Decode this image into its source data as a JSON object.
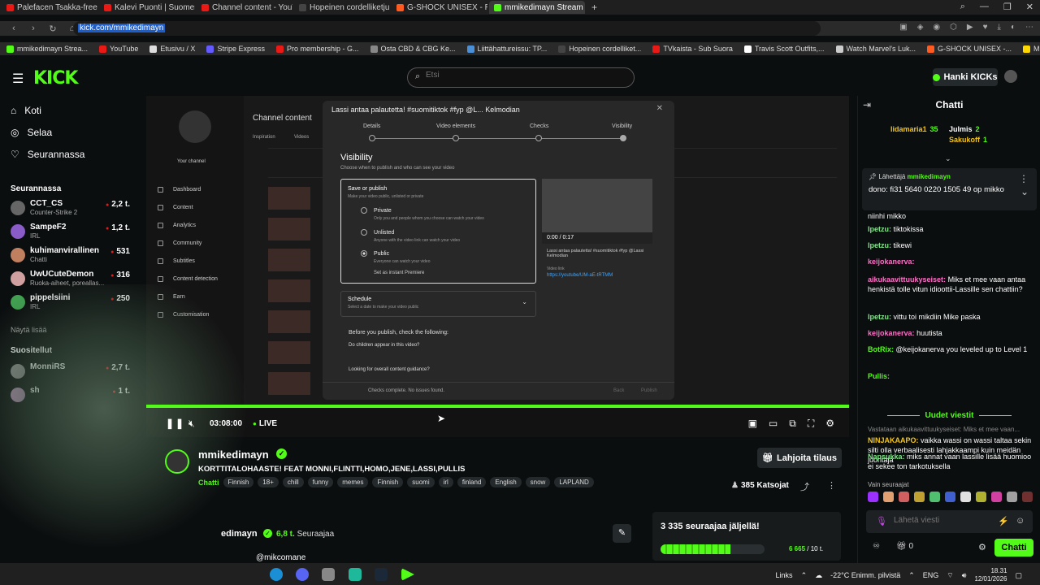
{
  "browser": {
    "tabs": [
      {
        "label": "Palefacen Tsakka-freestyl",
        "color": "#e91916",
        "active": false
      },
      {
        "label": "Kalevi Puonti | Suomen h",
        "color": "#e91916",
        "active": false
      },
      {
        "label": "Channel content - YouTu",
        "color": "#e91916",
        "active": false
      },
      {
        "label": "Hopeinen cordelliketju -",
        "color": "#444444",
        "active": false
      },
      {
        "label": "G-SHOCK UNISEX - Rann",
        "color": "#ff5a1f",
        "active": false
      },
      {
        "label": "mmikedimayn Stream -",
        "color": "#53fc18",
        "active": true
      }
    ],
    "url": "kick.com/mmikedimayn",
    "bookmarks": [
      {
        "label": "mmikedimayn Strea...",
        "color": "#53fc18"
      },
      {
        "label": "YouTube",
        "color": "#e91916"
      },
      {
        "label": "Etusivu / X",
        "color": "#dddddd"
      },
      {
        "label": "Stripe Express",
        "color": "#635bff"
      },
      {
        "label": "Pro membership - G...",
        "color": "#e91916"
      },
      {
        "label": "Osta CBD & CBG Ke...",
        "color": "#888888"
      },
      {
        "label": "Liittähattureissu: TP...",
        "color": "#4a90d9"
      },
      {
        "label": "Hopeinen cordelliket...",
        "color": "#444444"
      },
      {
        "label": "TVkaista - Sub Suora",
        "color": "#e91916"
      },
      {
        "label": "Travis Scott Outfits,...",
        "color": "#ffffff"
      },
      {
        "label": "Watch Marvel's Luk...",
        "color": "#cccccc"
      },
      {
        "label": "G-SHOCK UNISEX -...",
        "color": "#ff5a1f"
      },
      {
        "label": "Mighty Ducks: Bank...",
        "color": "#ffd700"
      }
    ]
  },
  "header": {
    "logo": "KICK",
    "search_placeholder": "Etsi",
    "kicks_label": "Hanki KICKs"
  },
  "sidebar": {
    "nav": [
      {
        "label": "Koti",
        "icon": "home-icon"
      },
      {
        "label": "Selaa",
        "icon": "compass-icon"
      },
      {
        "label": "Seurannassa",
        "icon": "heart-icon"
      }
    ],
    "following_title": "Seurannassa",
    "following": [
      {
        "name": "CCT_CS",
        "category": "Counter-Strike 2",
        "viewers": "2,2 t.",
        "color": "#666666"
      },
      {
        "name": "SampeF2",
        "category": "IRL",
        "viewers": "1,2 t.",
        "color": "#8a5cc8"
      },
      {
        "name": "kuhimanvirallinen",
        "category": "Chatti",
        "viewers": "531",
        "color": "#c08060"
      },
      {
        "name": "UwUCuteDemon",
        "category": "Ruoka-aiheet, poreallas...",
        "viewers": "316",
        "color": "#d0a0a0"
      },
      {
        "name": "pippelsiini",
        "category": "IRL",
        "viewers": "250",
        "color": "#40a050"
      }
    ],
    "show_more": "Näytä lisää",
    "recommended_title": "Suositellut",
    "recommended": [
      {
        "name": "MonniRS",
        "category": "",
        "viewers": "2,7 t.",
        "color": "#888888"
      },
      {
        "name": "sh",
        "category": "",
        "viewers": "1 t.",
        "color": "#aa88aa"
      }
    ]
  },
  "studio": {
    "page_title": "Channel content",
    "your_channel": "Your channel",
    "nav": [
      "Dashboard",
      "Content",
      "Analytics",
      "Community",
      "Subtitles",
      "Content detection",
      "Earn",
      "Customisation"
    ],
    "tabs": [
      "Inspiration",
      "Videos"
    ],
    "dialog": {
      "title": "Lassi antaa palautetta! #suomitiktok #fyp @L... Kelmodian",
      "steps": [
        "Details",
        "Video elements",
        "Checks",
        "Visibility"
      ],
      "visibility_title": "Visibility",
      "visibility_sub": "Choose when to publish and who can see your video",
      "save_title": "Save or publish",
      "save_sub": "Make your video public, unlisted or private",
      "options": [
        {
          "label": "Private",
          "sub": "Only you and people whom you choose can watch your video",
          "on": false
        },
        {
          "label": "Unlisted",
          "sub": "Anyone with the video link can watch your video",
          "on": false
        },
        {
          "label": "Public",
          "sub": "Everyone can watch your video",
          "on": true
        }
      ],
      "premiere": "Set as instant Premiere",
      "preview_time": "0:00 / 0:17",
      "video_title": "Lassi antaa palautetta! #suomitiktok #fyp @Lassi Kelmodian",
      "video_link_label": "Video link",
      "video_link": "https://youtube/UM-aE-tRTMM",
      "schedule": "Schedule",
      "schedule_sub": "Select a date to make your video public",
      "check_title": "Before you publish, check the following:",
      "check_1": "Do children appear in this video?",
      "check_2": "Looking for overall content guidance?",
      "footer_status": "Checks complete. No issues found.",
      "back": "Back",
      "publish": "Publish"
    }
  },
  "player": {
    "time": "03:08:00",
    "live": "LIVE"
  },
  "stream": {
    "name": "mmikedimayn",
    "title": "KORTTITALOHAASTE! FEAT MONNI,FLINTTI,HOMO,JENE,LASSI,PULLIS",
    "category": "Chatti",
    "tags": [
      "Finnish",
      "18+",
      "chill",
      "funny",
      "memes",
      "Finnish",
      "suomi",
      "irl",
      "finland",
      "English",
      "snow",
      "LAPLAND"
    ],
    "subscribe_label": "Lahjoita tilaus",
    "viewers": "385 Katsojat",
    "about_name": "edimayn",
    "followers_count": "6,8 t.",
    "followers_label": "Seuraajaa",
    "social": "@mikcomane",
    "goal_title": "3 335 seuraajaa jäljellä!",
    "goal_current": "6 665",
    "goal_target": "/ 10 t.",
    "goal_progress": 0.67
  },
  "chat": {
    "title": "Chatti",
    "leaders": [
      {
        "name": "lidamaria1",
        "val": "35",
        "color": "#f5c518"
      },
      {
        "name": "Julmis",
        "val": "2",
        "color": "#ffffff"
      },
      {
        "name": "Sakukoff",
        "val": "1",
        "color": "#f5c518"
      }
    ],
    "pinned_by": "Lähettäjä",
    "pinned_user": "mmikedimayn",
    "pinned_text": "dono: fi31 5640 0220 1505 49 op mikko",
    "messages": [
      {
        "user": "",
        "text": "niinhi mikko",
        "color": "#ffffff"
      },
      {
        "user": "Ipetzu:",
        "text": "tiktokissa",
        "color": "#7ee787"
      },
      {
        "user": "Ipetzu:",
        "text": "tikewi",
        "color": "#7ee787"
      },
      {
        "user": "keijokanerva:",
        "text": "",
        "color": "#ff6ec7"
      },
      {
        "user": "aikukaavittuukyseiset:",
        "text": "Miks et mee vaan antaa henkistä tolle vitun idioottii-Lassille sen chattiin?",
        "color": "#ff6ec7"
      },
      {
        "user": "Ipetzu:",
        "text": "vittu toi mikdiin Mike paska",
        "color": "#7ee787"
      },
      {
        "user": "keijokanerva:",
        "text": "huutista",
        "color": "#ff6ec7"
      },
      {
        "user": "BotRix:",
        "text": "@keijokanerva you leveled up to Level 1",
        "color": "#53fc18"
      },
      {
        "user": "Pullis:",
        "text": "",
        "color": "#53fc18"
      }
    ],
    "new_messages": "Uudet viestit",
    "reply_to": "Vastataan aikukaavittuukyseiset: Miks et mee vaan...",
    "new_msgs": [
      {
        "user": "NINJAKAAPO:",
        "text": "vaikka wassi on wassi taltaa sekin silti olla verbaalisesti lahjakkaampi kuin meidän juontaja",
        "color": "#f5c518"
      },
      {
        "user": "Napsukka:",
        "text": "miks annat vaan lassille lisää huomioo ei sekee ton tarkotuksella",
        "color": "#7ee787"
      }
    ],
    "subs_only": "Vain seuraajat",
    "input_placeholder": "Lähetä viesti",
    "send_label": "Chatti",
    "points": "0"
  },
  "taskbar": {
    "links": "Links",
    "weather": "-22°C Enimm. pilvistä",
    "lang": "ENG",
    "time": "18.31",
    "date": "12/01/2026"
  }
}
